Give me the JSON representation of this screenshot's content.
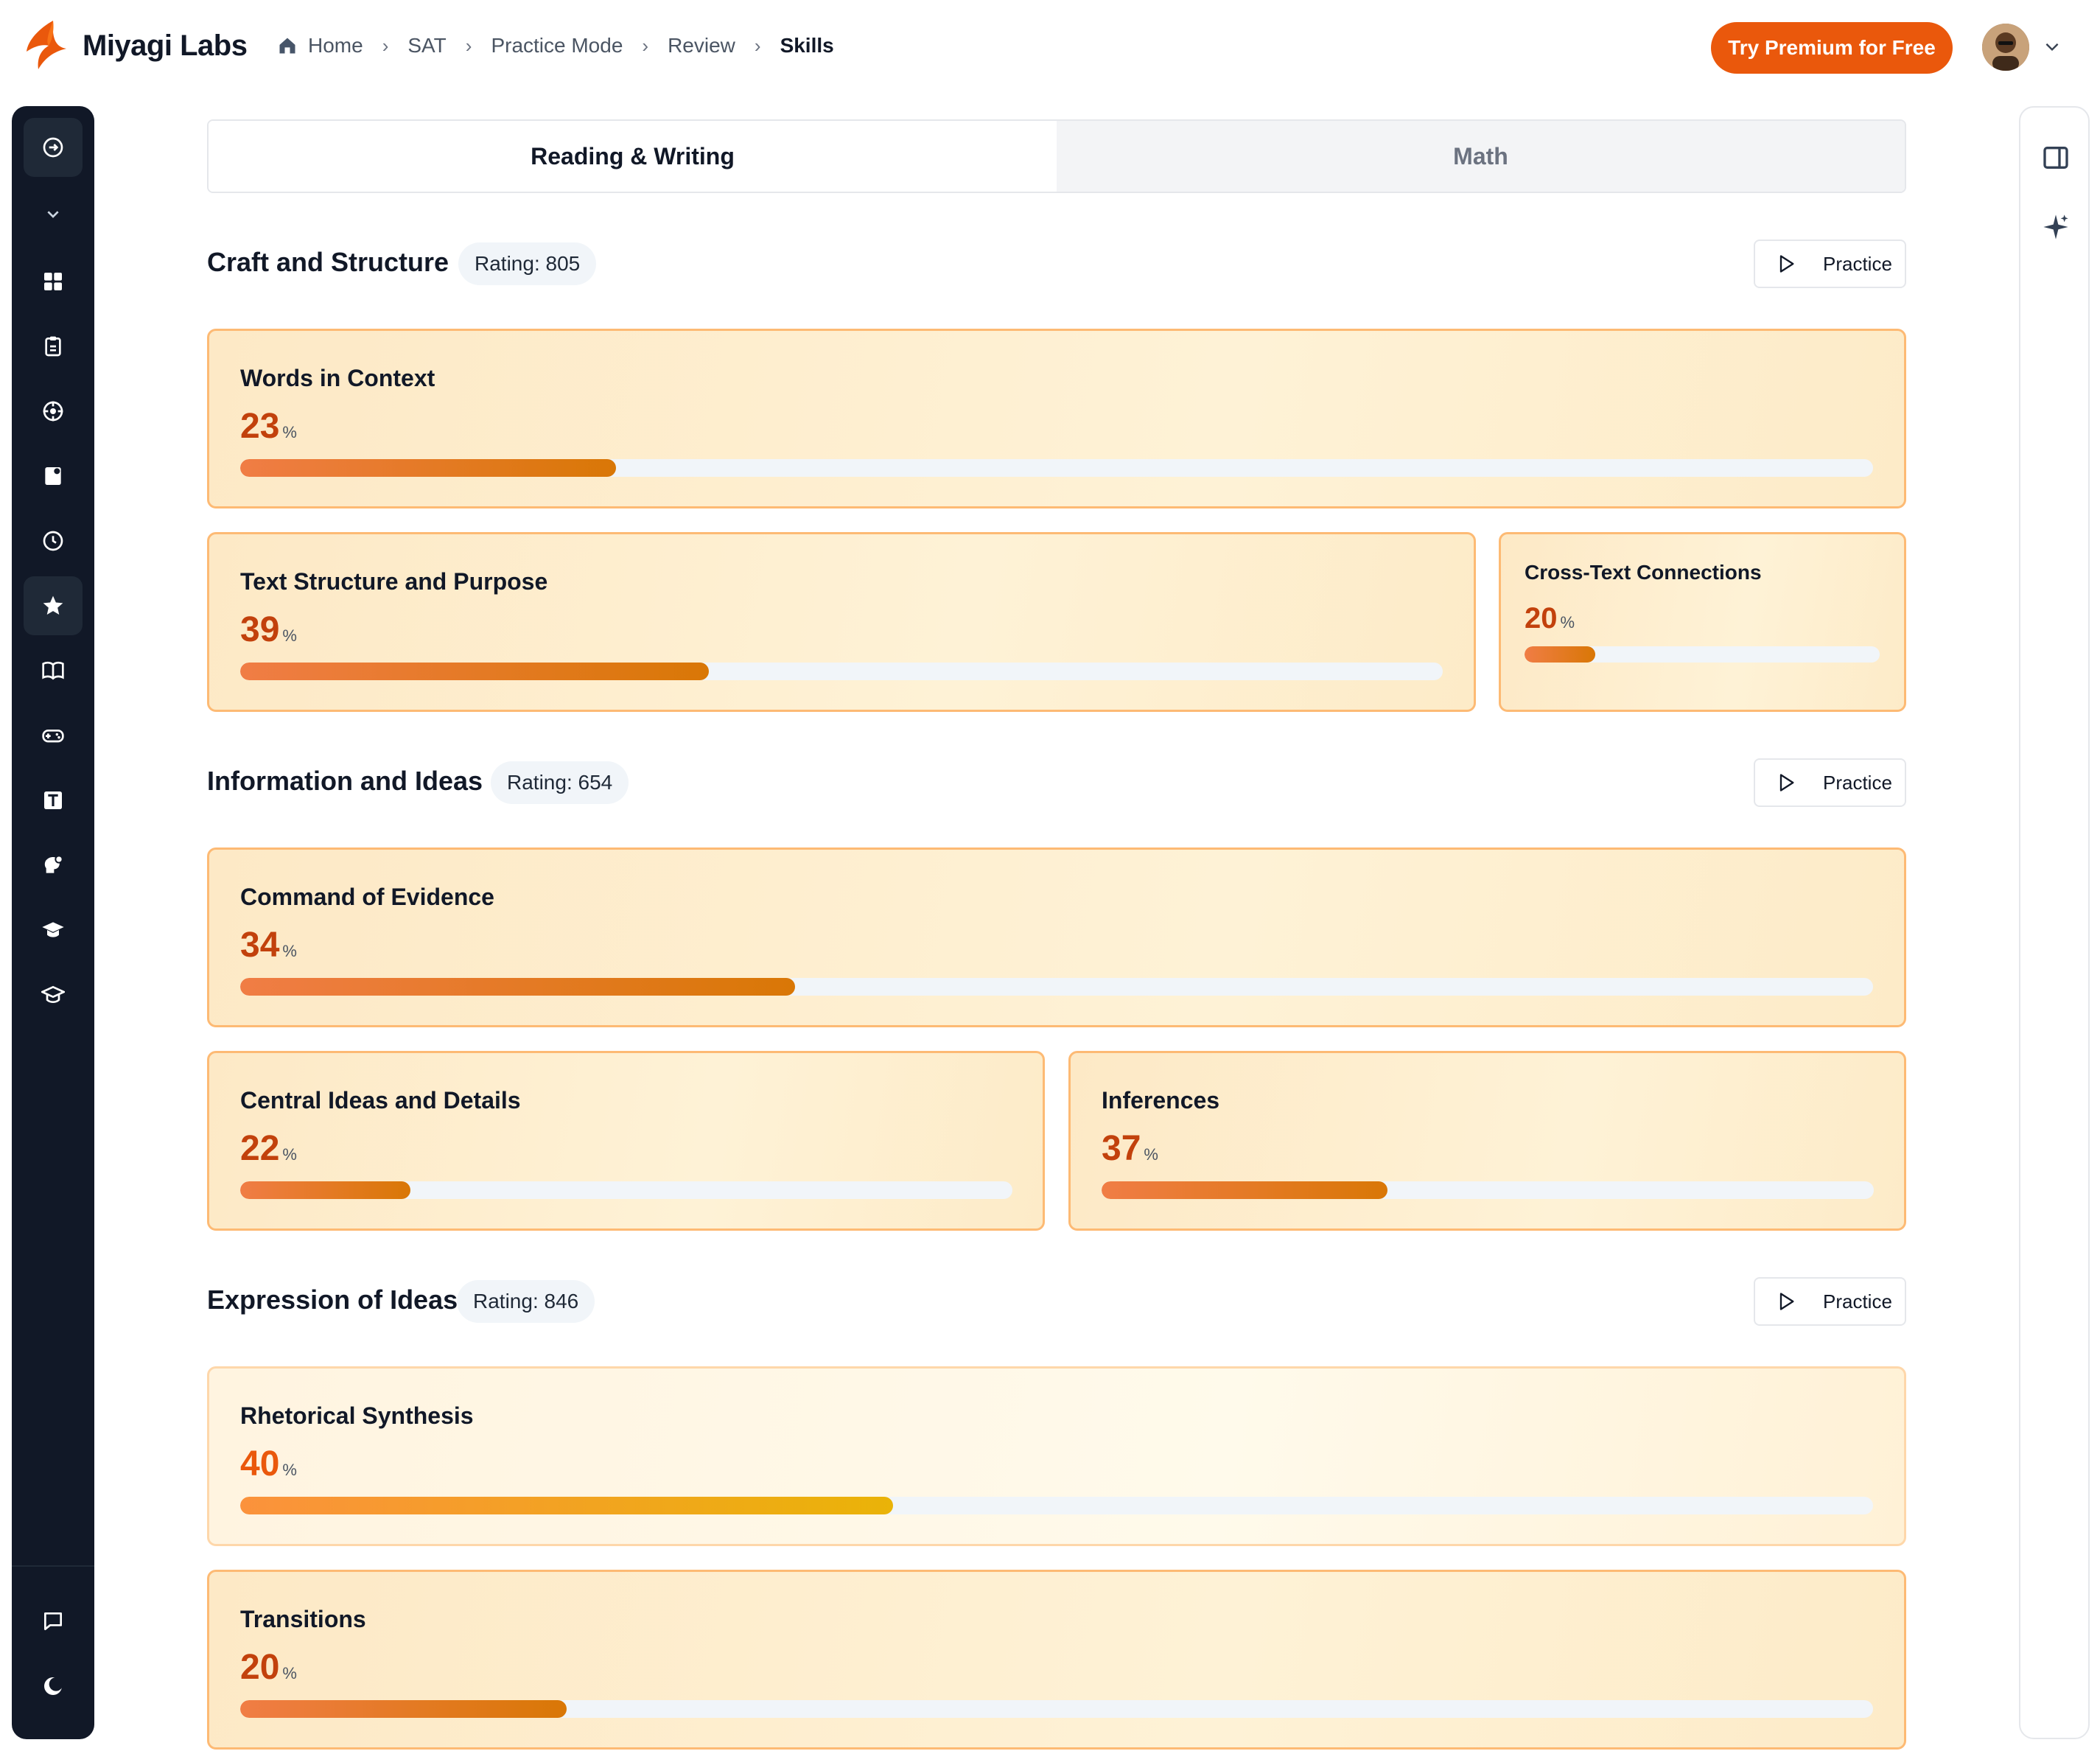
{
  "header": {
    "brand": "Miyagi Labs",
    "breadcrumbs": [
      "Home",
      "SAT",
      "Practice Mode",
      "Review",
      "Skills"
    ],
    "premium_label": "Try Premium for Free",
    "accent_color": "#ea580c"
  },
  "sidebar": {
    "icons": [
      "expand-icon",
      "chevron-down-icon",
      "dashboard-icon",
      "clipboard-icon",
      "target-icon",
      "notebook-icon",
      "clock-icon",
      "star-icon",
      "book-icon",
      "gamepad-icon",
      "text-icon",
      "brain-icon",
      "graduation-cap-icon",
      "graduation-cap-outline-icon",
      "chat-icon",
      "theme-icon"
    ],
    "active": "star-icon"
  },
  "rail": {
    "icons": [
      "panel-icon",
      "sparkle-icon"
    ]
  },
  "tabs": [
    {
      "label": "Reading & Writing",
      "active": true
    },
    {
      "label": "Math",
      "active": false
    }
  ],
  "sections": [
    {
      "title": "Craft and Structure",
      "rating": "Rating: 805",
      "practice_label": "Practice",
      "skills": [
        {
          "name": "Words in Context",
          "percent": 23,
          "pct_label": "23",
          "unit": "%"
        },
        {
          "name": "Text Structure and Purpose",
          "percent": 39,
          "pct_label": "39",
          "unit": "%"
        },
        {
          "name": "Cross-Text Connections",
          "percent": 20,
          "pct_label": "20",
          "unit": "%"
        }
      ]
    },
    {
      "title": "Information and Ideas",
      "rating": "Rating: 654",
      "practice_label": "Practice",
      "skills": [
        {
          "name": "Command of Evidence",
          "percent": 34,
          "pct_label": "34",
          "unit": "%"
        },
        {
          "name": "Central Ideas and Details",
          "percent": 22,
          "pct_label": "22",
          "unit": "%"
        },
        {
          "name": "Inferences",
          "percent": 37,
          "pct_label": "37",
          "unit": "%"
        }
      ]
    },
    {
      "title": "Expression of Ideas",
      "rating": "Rating: 846",
      "practice_label": "Practice",
      "skills": [
        {
          "name": "Rhetorical Synthesis",
          "percent": 40,
          "pct_label": "40",
          "unit": "%"
        },
        {
          "name": "Transitions",
          "percent": 20,
          "pct_label": "20",
          "unit": "%"
        }
      ]
    }
  ]
}
